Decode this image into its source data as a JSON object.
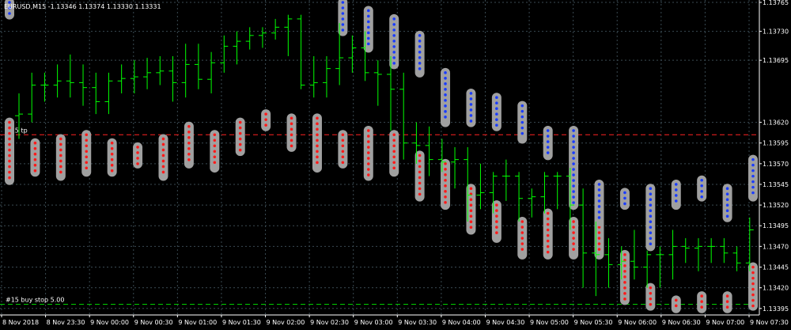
{
  "header": {
    "symbol_text": "EURUSD,M15 -1.13346 1.13374 1.13330 1.13331"
  },
  "colors": {
    "background": "#000000",
    "grid": "#3a4a52",
    "bar": "#00ff00",
    "order_level": "#ff2222",
    "buy_stop_level": "#00cc00",
    "sell_marker": "#ff1a1a",
    "buy_marker": "#1a3cff",
    "marker_halo": "#a0a0a0",
    "axis_text": "#ffffff"
  },
  "chart_data": {
    "type": "ohlc",
    "symbol": "EURUSD",
    "timeframe": "M15",
    "ylim": [
      1.1339,
      1.13765
    ],
    "grid": true,
    "price_ticks": [
      "1.13765",
      "1.13730",
      "1.13695",
      "1.13620",
      "1.13595",
      "1.13570",
      "1.13545",
      "1.13520",
      "1.13495",
      "1.13470",
      "1.13445",
      "1.13420",
      "1.13395"
    ],
    "time_ticks": [
      "8 Nov 2018",
      "8 Nov 23:30",
      "9 Nov 00:00",
      "9 Nov 00:30",
      "9 Nov 01:00",
      "9 Nov 01:30",
      "9 Nov 02:00",
      "9 Nov 02:30",
      "9 Nov 03:00",
      "9 Nov 03:30",
      "9 Nov 04:00",
      "9 Nov 04:30",
      "9 Nov 05:00",
      "9 Nov 05:30",
      "9 Nov 06:00",
      "9 Nov 06:30",
      "9 Nov 07:00",
      "9 Nov 07:30"
    ],
    "levels": [
      {
        "label": "#15 tp",
        "price": 1.13605,
        "color": "#ff2222"
      },
      {
        "label": "#15 buy stop 5.00",
        "price": 1.134,
        "color": "#00cc00"
      }
    ],
    "bars": [
      {
        "open": 1.13628,
        "high": 1.13655,
        "low": 1.136,
        "close": 1.1363
      },
      {
        "open": 1.1363,
        "high": 1.1368,
        "low": 1.1362,
        "close": 1.13665
      },
      {
        "open": 1.13665,
        "high": 1.1368,
        "low": 1.13645,
        "close": 1.13665
      },
      {
        "open": 1.13665,
        "high": 1.1369,
        "low": 1.1365,
        "close": 1.1367
      },
      {
        "open": 1.1367,
        "high": 1.13702,
        "low": 1.1365,
        "close": 1.13668
      },
      {
        "open": 1.13668,
        "high": 1.1369,
        "low": 1.1364,
        "close": 1.13662
      },
      {
        "open": 1.13662,
        "high": 1.1368,
        "low": 1.1363,
        "close": 1.13645
      },
      {
        "open": 1.13645,
        "high": 1.1368,
        "low": 1.1363,
        "close": 1.1367
      },
      {
        "open": 1.1367,
        "high": 1.1369,
        "low": 1.13655,
        "close": 1.13673
      },
      {
        "open": 1.13673,
        "high": 1.13695,
        "low": 1.13655,
        "close": 1.13675
      },
      {
        "open": 1.13675,
        "high": 1.13698,
        "low": 1.1366,
        "close": 1.1368
      },
      {
        "open": 1.1368,
        "high": 1.137,
        "low": 1.13665,
        "close": 1.13682
      },
      {
        "open": 1.13682,
        "high": 1.137,
        "low": 1.13645,
        "close": 1.13668
      },
      {
        "open": 1.13668,
        "high": 1.13715,
        "low": 1.1365,
        "close": 1.1369
      },
      {
        "open": 1.1369,
        "high": 1.13715,
        "low": 1.1366,
        "close": 1.13672
      },
      {
        "open": 1.13672,
        "high": 1.13705,
        "low": 1.13655,
        "close": 1.13692
      },
      {
        "open": 1.13692,
        "high": 1.13725,
        "low": 1.1368,
        "close": 1.13712
      },
      {
        "open": 1.13712,
        "high": 1.1373,
        "low": 1.1369,
        "close": 1.13718
      },
      {
        "open": 1.13718,
        "high": 1.13735,
        "low": 1.13708,
        "close": 1.13725
      },
      {
        "open": 1.13725,
        "high": 1.13735,
        "low": 1.1371,
        "close": 1.13728
      },
      {
        "open": 1.13728,
        "high": 1.13745,
        "low": 1.1372,
        "close": 1.13735
      },
      {
        "open": 1.13735,
        "high": 1.1375,
        "low": 1.137,
        "close": 1.13745
      },
      {
        "open": 1.13745,
        "high": 1.1375,
        "low": 1.1366,
        "close": 1.13665
      },
      {
        "open": 1.13665,
        "high": 1.137,
        "low": 1.1365,
        "close": 1.13668
      },
      {
        "open": 1.13668,
        "high": 1.137,
        "low": 1.1365,
        "close": 1.13685
      },
      {
        "open": 1.13685,
        "high": 1.1374,
        "low": 1.13665,
        "close": 1.13698
      },
      {
        "open": 1.13698,
        "high": 1.13725,
        "low": 1.1368,
        "close": 1.1371
      },
      {
        "open": 1.1371,
        "high": 1.1373,
        "low": 1.1367,
        "close": 1.1368
      },
      {
        "open": 1.1368,
        "high": 1.13695,
        "low": 1.1364,
        "close": 1.13678
      },
      {
        "open": 1.13678,
        "high": 1.137,
        "low": 1.1361,
        "close": 1.1366
      },
      {
        "open": 1.1366,
        "high": 1.1368,
        "low": 1.13575,
        "close": 1.13595
      },
      {
        "open": 1.13595,
        "high": 1.1362,
        "low": 1.1357,
        "close": 1.13592
      },
      {
        "open": 1.13592,
        "high": 1.13615,
        "low": 1.13555,
        "close": 1.13575
      },
      {
        "open": 1.13575,
        "high": 1.136,
        "low": 1.1356,
        "close": 1.13572
      },
      {
        "open": 1.13572,
        "high": 1.1359,
        "low": 1.1354,
        "close": 1.13575
      },
      {
        "open": 1.13575,
        "high": 1.1359,
        "low": 1.135,
        "close": 1.13532
      },
      {
        "open": 1.13532,
        "high": 1.1357,
        "low": 1.13515,
        "close": 1.13535
      },
      {
        "open": 1.13535,
        "high": 1.1356,
        "low": 1.1351,
        "close": 1.13555
      },
      {
        "open": 1.13555,
        "high": 1.13575,
        "low": 1.13525,
        "close": 1.13555
      },
      {
        "open": 1.13555,
        "high": 1.1356,
        "low": 1.135,
        "close": 1.13528
      },
      {
        "open": 1.13528,
        "high": 1.1354,
        "low": 1.13505,
        "close": 1.1353
      },
      {
        "open": 1.1353,
        "high": 1.1356,
        "low": 1.1351,
        "close": 1.13555
      },
      {
        "open": 1.13555,
        "high": 1.1356,
        "low": 1.13515,
        "close": 1.13555
      },
      {
        "open": 1.13555,
        "high": 1.13565,
        "low": 1.1349,
        "close": 1.1352
      },
      {
        "open": 1.1352,
        "high": 1.1354,
        "low": 1.1342,
        "close": 1.13462
      },
      {
        "open": 1.13462,
        "high": 1.135,
        "low": 1.1341,
        "close": 1.1346
      },
      {
        "open": 1.1346,
        "high": 1.1348,
        "low": 1.1342,
        "close": 1.13448
      },
      {
        "open": 1.13448,
        "high": 1.1347,
        "low": 1.1343,
        "close": 1.13452
      },
      {
        "open": 1.13452,
        "high": 1.1349,
        "low": 1.1343,
        "close": 1.13445
      },
      {
        "open": 1.13445,
        "high": 1.13465,
        "low": 1.1342,
        "close": 1.1346
      },
      {
        "open": 1.1346,
        "high": 1.1347,
        "low": 1.1342,
        "close": 1.1346
      },
      {
        "open": 1.1346,
        "high": 1.1349,
        "low": 1.1343,
        "close": 1.1347
      },
      {
        "open": 1.1347,
        "high": 1.1348,
        "low": 1.1345,
        "close": 1.13468
      },
      {
        "open": 1.13468,
        "high": 1.1348,
        "low": 1.1344,
        "close": 1.1347
      },
      {
        "open": 1.1347,
        "high": 1.1348,
        "low": 1.1345,
        "close": 1.1347
      },
      {
        "open": 1.1347,
        "high": 1.1348,
        "low": 1.1345,
        "close": 1.13462
      },
      {
        "open": 1.13462,
        "high": 1.1347,
        "low": 1.1344,
        "close": 1.1345
      },
      {
        "open": 1.1345,
        "high": 1.13505,
        "low": 1.1344,
        "close": 1.1349
      }
    ],
    "sell_marker_columns": [
      {
        "bar": 0,
        "from": 1.1362,
        "to": 1.1355
      },
      {
        "bar": 2,
        "from": 1.13595,
        "to": 1.1356
      },
      {
        "bar": 4,
        "from": 1.136,
        "to": 1.13555
      },
      {
        "bar": 6,
        "from": 1.13605,
        "to": 1.1356
      },
      {
        "bar": 8,
        "from": 1.13595,
        "to": 1.1356
      },
      {
        "bar": 10,
        "from": 1.1359,
        "to": 1.1357
      },
      {
        "bar": 12,
        "from": 1.136,
        "to": 1.13555
      },
      {
        "bar": 14,
        "from": 1.13615,
        "to": 1.1357
      },
      {
        "bar": 16,
        "from": 1.13605,
        "to": 1.13565
      },
      {
        "bar": 18,
        "from": 1.1362,
        "to": 1.13585
      },
      {
        "bar": 20,
        "from": 1.1363,
        "to": 1.13615
      },
      {
        "bar": 22,
        "from": 1.13625,
        "to": 1.1359
      },
      {
        "bar": 24,
        "from": 1.13625,
        "to": 1.13565
      },
      {
        "bar": 26,
        "from": 1.13605,
        "to": 1.1357
      },
      {
        "bar": 28,
        "from": 1.1361,
        "to": 1.13555
      },
      {
        "bar": 30,
        "from": 1.13605,
        "to": 1.1356
      },
      {
        "bar": 32,
        "from": 1.1358,
        "to": 1.1353
      },
      {
        "bar": 34,
        "from": 1.1357,
        "to": 1.1352
      },
      {
        "bar": 36,
        "from": 1.1354,
        "to": 1.1349
      },
      {
        "bar": 38,
        "from": 1.1352,
        "to": 1.1348
      },
      {
        "bar": 40,
        "from": 1.135,
        "to": 1.1346
      },
      {
        "bar": 42,
        "from": 1.1351,
        "to": 1.1346
      },
      {
        "bar": 44,
        "from": 1.135,
        "to": 1.1346
      },
      {
        "bar": 46,
        "from": 1.135,
        "to": 1.1346
      },
      {
        "bar": 48,
        "from": 1.1346,
        "to": 1.13405
      },
      {
        "bar": 50,
        "from": 1.1342,
        "to": 1.13398
      },
      {
        "bar": 52,
        "from": 1.13405,
        "to": 1.13395
      },
      {
        "bar": 54,
        "from": 1.1341,
        "to": 1.13395
      },
      {
        "bar": 56,
        "from": 1.1341,
        "to": 1.13395
      },
      {
        "bar": 58,
        "from": 1.13445,
        "to": 1.13398
      }
    ],
    "buy_marker_columns": [
      {
        "bar": 0,
        "from": 1.13765,
        "to": 1.1375
      },
      {
        "bar": 26,
        "from": 1.13765,
        "to": 1.1373
      },
      {
        "bar": 28,
        "from": 1.13755,
        "to": 1.1371
      },
      {
        "bar": 30,
        "from": 1.13745,
        "to": 1.1369
      },
      {
        "bar": 32,
        "from": 1.13725,
        "to": 1.1368
      },
      {
        "bar": 34,
        "from": 1.1368,
        "to": 1.1362
      },
      {
        "bar": 36,
        "from": 1.13655,
        "to": 1.1362
      },
      {
        "bar": 38,
        "from": 1.1365,
        "to": 1.13615
      },
      {
        "bar": 40,
        "from": 1.1364,
        "to": 1.136
      },
      {
        "bar": 42,
        "from": 1.1361,
        "to": 1.1358
      },
      {
        "bar": 44,
        "from": 1.1361,
        "to": 1.1352
      },
      {
        "bar": 46,
        "from": 1.13545,
        "to": 1.135
      },
      {
        "bar": 48,
        "from": 1.13535,
        "to": 1.1352
      },
      {
        "bar": 50,
        "from": 1.1354,
        "to": 1.1347
      },
      {
        "bar": 52,
        "from": 1.13545,
        "to": 1.1352
      },
      {
        "bar": 54,
        "from": 1.1355,
        "to": 1.1353
      },
      {
        "bar": 56,
        "from": 1.1354,
        "to": 1.13505
      },
      {
        "bar": 58,
        "from": 1.13575,
        "to": 1.1353
      }
    ]
  }
}
